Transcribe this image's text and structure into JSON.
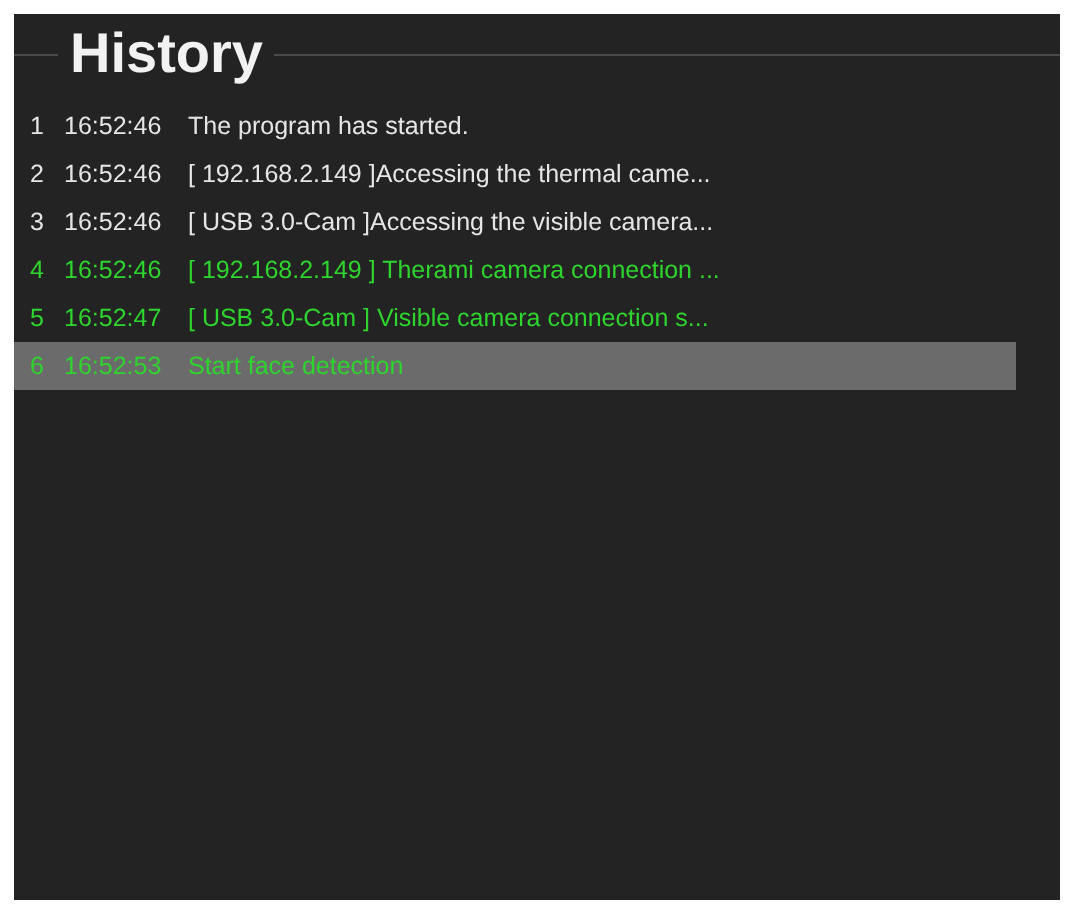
{
  "panel": {
    "title": "History"
  },
  "rows": [
    {
      "index": "1",
      "time": "16:52:46",
      "message": "The program has started.",
      "kind": "info",
      "selected": false
    },
    {
      "index": "2",
      "time": "16:52:46",
      "message": "[ 192.168.2.149 ]Accessing the thermal came...",
      "kind": "info",
      "selected": false
    },
    {
      "index": "3",
      "time": "16:52:46",
      "message": "[ USB 3.0-Cam ]Accessing the visible camera...",
      "kind": "info",
      "selected": false
    },
    {
      "index": "4",
      "time": "16:52:46",
      "message": "[ 192.168.2.149 ] Therami camera connection ...",
      "kind": "success",
      "selected": false
    },
    {
      "index": "5",
      "time": "16:52:47",
      "message": "[ USB 3.0-Cam ] Visible camera connection s...",
      "kind": "success",
      "selected": false
    },
    {
      "index": "6",
      "time": "16:52:53",
      "message": "Start face detection",
      "kind": "success",
      "selected": true
    }
  ]
}
